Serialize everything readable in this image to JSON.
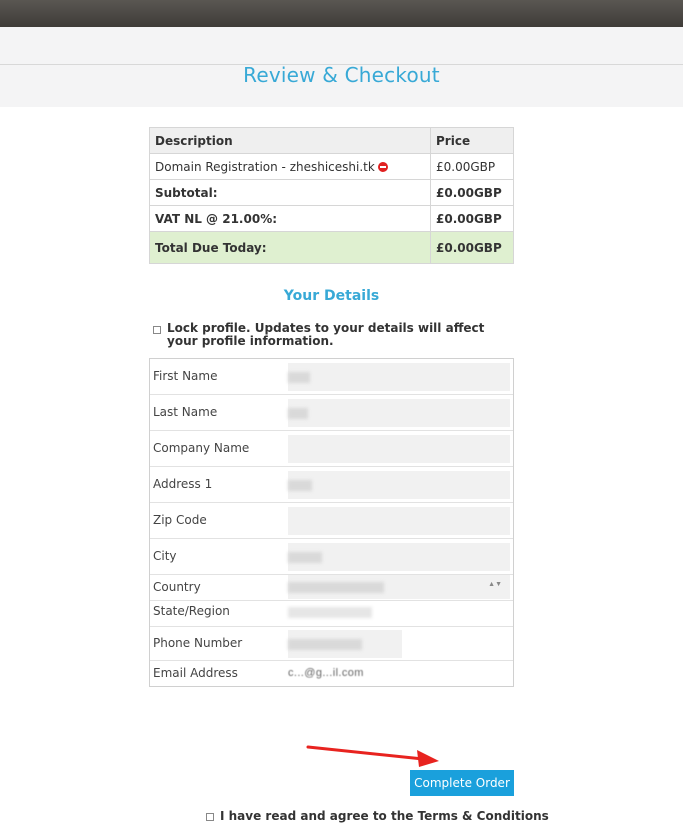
{
  "page": {
    "title": "Review & Checkout",
    "accent_color": "#38a9d6",
    "button_color": "#1aa0dc",
    "total_row_color": "#dff0d0"
  },
  "summary": {
    "headers": [
      "Description",
      "Price"
    ],
    "items": [
      {
        "description": "Domain Registration - zheshiceshi.tk",
        "price": "£0.00GBP",
        "icon": "remove-icon"
      }
    ],
    "subtotal_label": "Subtotal:",
    "subtotal_value": "£0.00GBP",
    "vat_label": "VAT NL @ 21.00%:",
    "vat_value": "£0.00GBP",
    "total_label": "Total Due Today:",
    "total_value": "£0.00GBP"
  },
  "details": {
    "section_title": "Your Details",
    "lock_profile_label": "Lock profile. Updates to your details will affect your profile information.",
    "fields": {
      "first_name": "First Name",
      "last_name": "Last Name",
      "company_name": "Company Name",
      "address1": "Address 1",
      "zip_code": "Zip Code",
      "city": "City",
      "country": "Country",
      "state": "State/Region",
      "phone": "Phone Number",
      "email": "Email Address"
    },
    "email_value": "c...@g...il.com"
  },
  "actions": {
    "complete_order_label": "Complete Order",
    "terms_label": "I have read and agree to the Terms & Conditions"
  }
}
